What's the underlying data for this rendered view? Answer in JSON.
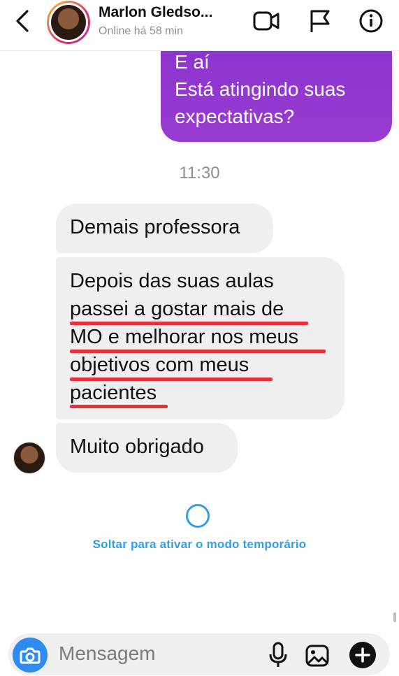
{
  "header": {
    "name": "Marlon Gledso...",
    "status": "Online há 58 min"
  },
  "messages": {
    "outgoing_lines": [
      "E aí",
      "Está atingindo suas",
      "expectativas?"
    ],
    "timestamp": "11:30",
    "incoming_1": "Demais professora",
    "incoming_2_lines": [
      "Depois das suas aulas",
      "passei a gostar mais de",
      "MO e melhorar nos meus",
      "objetivos com meus",
      "pacientes"
    ],
    "incoming_3": "Muito obrigado"
  },
  "vanish_mode": {
    "label": "Soltar para ativar o modo temporário"
  },
  "composer": {
    "placeholder": "Mensagem"
  },
  "colors": {
    "accent_blue": "#2f9fe8",
    "outgoing_bubble": "#9a3bd0",
    "incoming_bubble": "#efefef",
    "underline_red": "#e8303b"
  },
  "icons": [
    "back-chevron-icon",
    "video-camera-icon",
    "flag-icon",
    "info-icon",
    "camera-icon",
    "microphone-icon",
    "gallery-icon",
    "plus-icon"
  ]
}
